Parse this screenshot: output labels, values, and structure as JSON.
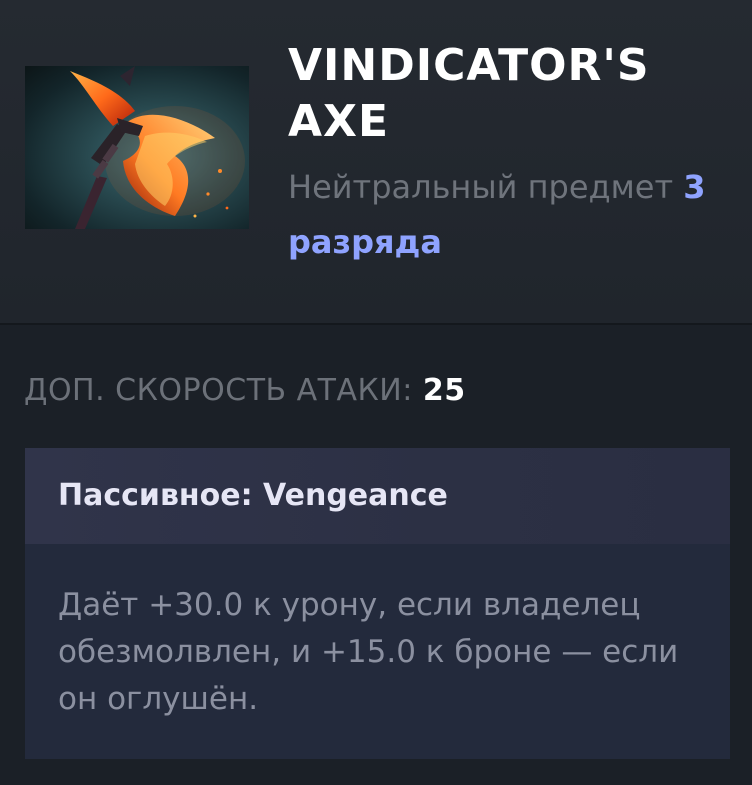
{
  "item": {
    "name": "VINDICATOR'S AXE",
    "type_prefix": "Нейтральный предмет",
    "tier": "3 разряда",
    "icon": "vindicators-axe-icon"
  },
  "stats": {
    "label": "ДОП. СКОРОСТЬ АТАКИ:",
    "value": "25"
  },
  "ability": {
    "title": "Пассивное: Vengeance",
    "description": "Даёт +30.0 к урону, если владелец обезмолвлен, и +15.0 к броне — если он оглушён."
  },
  "colors": {
    "background": "#1b2027",
    "tier_accent": "#8fa3ff",
    "ability_box": "#232a3c"
  }
}
